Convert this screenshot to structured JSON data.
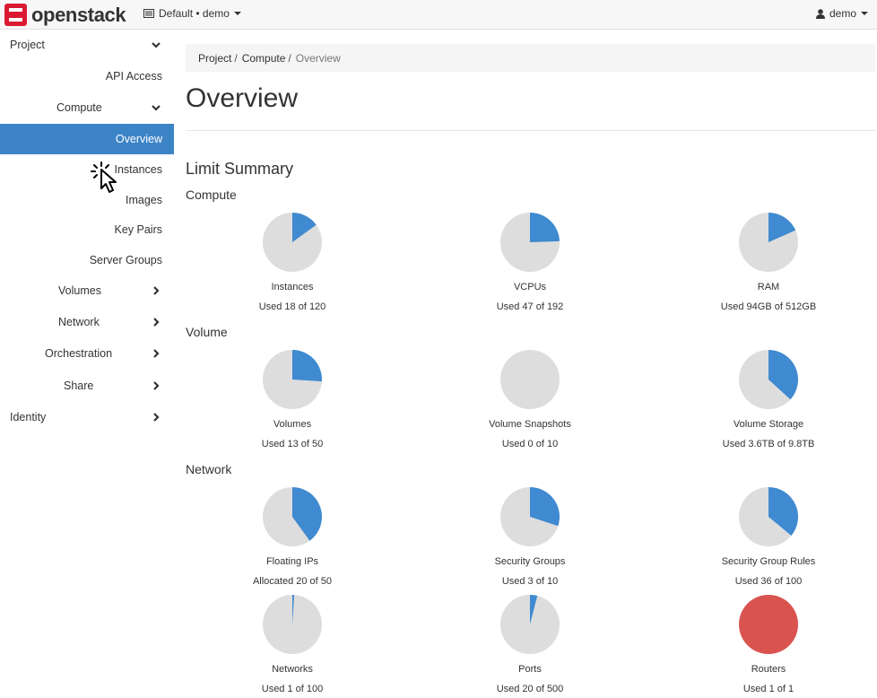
{
  "topbar": {
    "brand": "openstack",
    "project_switch": "Default • demo",
    "user": "demo"
  },
  "sidebar": {
    "project": "Project",
    "api_access": "API Access",
    "compute": "Compute",
    "overview": "Overview",
    "instances": "Instances",
    "images": "Images",
    "key_pairs": "Key Pairs",
    "server_groups": "Server Groups",
    "volumes": "Volumes",
    "network": "Network",
    "orchestration": "Orchestration",
    "share": "Share",
    "identity": "Identity"
  },
  "breadcrumb": {
    "item1": "Project",
    "item2": "Compute",
    "current": "Overview",
    "sep": "/"
  },
  "page": {
    "title": "Overview",
    "summary_title": "Limit Summary",
    "section_compute": "Compute",
    "section_volume": "Volume",
    "section_network": "Network"
  },
  "colors": {
    "used": "#3f8ad0",
    "free": "#dddddd",
    "full": "#d9534f",
    "active_nav": "#3d84c6"
  },
  "chart_data": [
    {
      "type": "pie",
      "label": "Instances",
      "usage": "Used 18 of 120",
      "used": 18,
      "total": 120
    },
    {
      "type": "pie",
      "label": "VCPUs",
      "usage": "Used 47 of 192",
      "used": 47,
      "total": 192
    },
    {
      "type": "pie",
      "label": "RAM",
      "usage": "Used 94GB of 512GB",
      "used": 94,
      "total": 512
    },
    {
      "type": "pie",
      "label": "Volumes",
      "usage": "Used 13 of 50",
      "used": 13,
      "total": 50
    },
    {
      "type": "pie",
      "label": "Volume Snapshots",
      "usage": "Used 0 of 10",
      "used": 0,
      "total": 10
    },
    {
      "type": "pie",
      "label": "Volume Storage",
      "usage": "Used 3.6TB of 9.8TB",
      "used": 3.6,
      "total": 9.8
    },
    {
      "type": "pie",
      "label": "Floating IPs",
      "usage": "Allocated 20 of 50",
      "used": 20,
      "total": 50
    },
    {
      "type": "pie",
      "label": "Security Groups",
      "usage": "Used 3 of 10",
      "used": 3,
      "total": 10
    },
    {
      "type": "pie",
      "label": "Security Group Rules",
      "usage": "Used 36 of 100",
      "used": 36,
      "total": 100
    },
    {
      "type": "pie",
      "label": "Networks",
      "usage": "Used 1 of 100",
      "used": 1,
      "total": 100
    },
    {
      "type": "pie",
      "label": "Ports",
      "usage": "Used 20 of 500",
      "used": 20,
      "total": 500
    },
    {
      "type": "pie",
      "label": "Routers",
      "usage": "Used 1 of 1",
      "used": 1,
      "total": 1
    }
  ]
}
